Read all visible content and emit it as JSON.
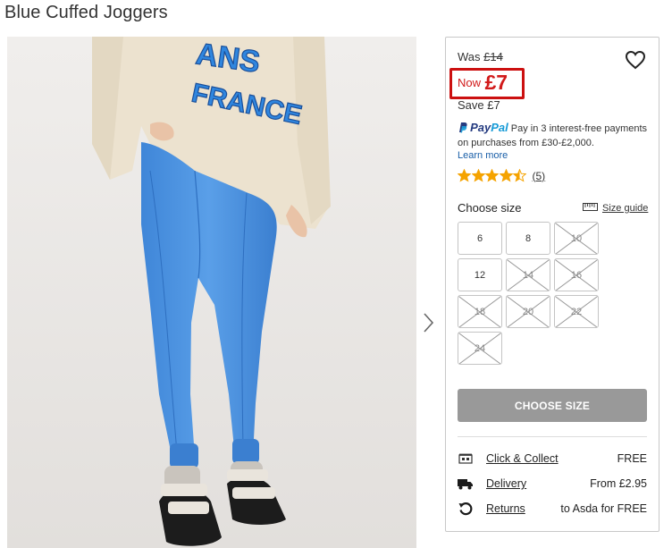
{
  "product": {
    "title": "Blue Cuffed Joggers"
  },
  "price": {
    "was_label": "Was",
    "was_value": "£14",
    "now_label": "Now",
    "now_value": "£7",
    "save_label": "Save",
    "save_value": "£7"
  },
  "paypal": {
    "brand_pay": "Pay",
    "brand_pal": "Pal",
    "message": "Pay in 3 interest-free payments on purchases from £30-£2,000.",
    "learn_more": "Learn more"
  },
  "rating": {
    "stars": 4.5,
    "out_of": 5,
    "count_label": "(5)"
  },
  "size": {
    "heading": "Choose size",
    "guide_label": "Size guide",
    "options": [
      {
        "label": "6",
        "available": true
      },
      {
        "label": "8",
        "available": true
      },
      {
        "label": "10",
        "available": false
      },
      {
        "label": "12",
        "available": true
      },
      {
        "label": "14",
        "available": false
      },
      {
        "label": "16",
        "available": false
      },
      {
        "label": "18",
        "available": false
      },
      {
        "label": "20",
        "available": false
      },
      {
        "label": "22",
        "available": false
      },
      {
        "label": "24",
        "available": false
      }
    ]
  },
  "cta": {
    "label": "CHOOSE SIZE"
  },
  "services": [
    {
      "icon": "store-icon",
      "link": "Click & Collect",
      "value": "FREE"
    },
    {
      "icon": "delivery-truck-icon",
      "link": "Delivery",
      "value": "From £2.95"
    },
    {
      "icon": "returns-icon",
      "link": "Returns",
      "value": "to Asda for FREE"
    }
  ],
  "colors": {
    "price_red": "#d11a1a",
    "star": "#f5a300",
    "cta_disabled": "#999999",
    "paypal_dark": "#253b80",
    "paypal_light": "#179bd7"
  },
  "image": {
    "sweatshirt_print": "FRANCE"
  }
}
